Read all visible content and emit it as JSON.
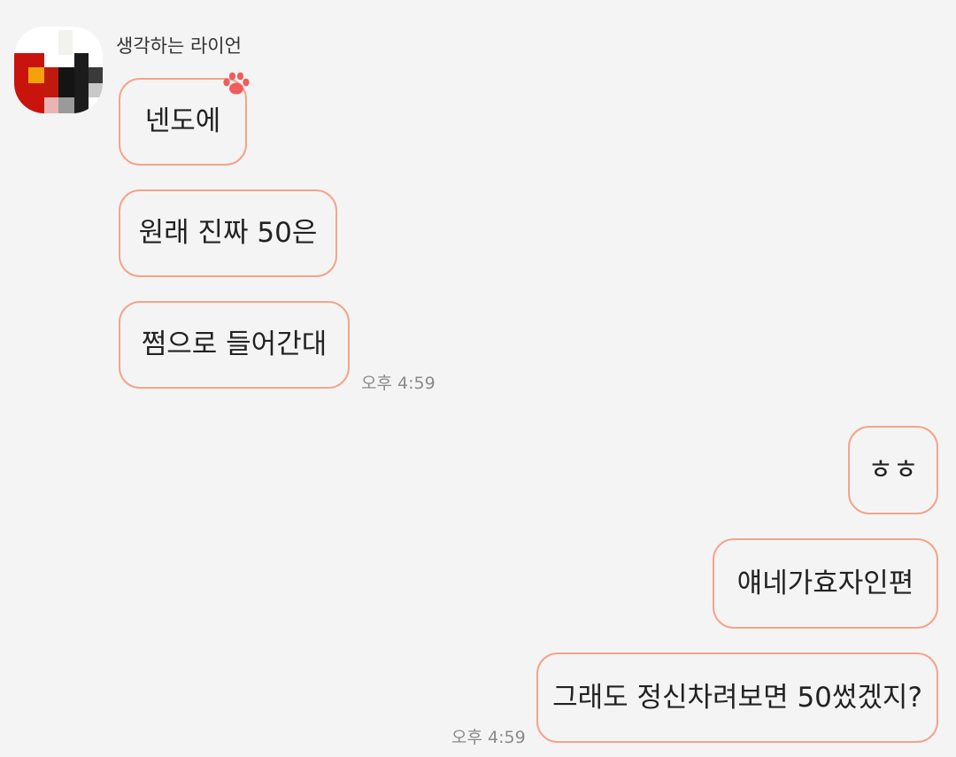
{
  "chat": {
    "sender_name": "생각하는 라이언",
    "incoming": [
      {
        "text": "넨도에"
      },
      {
        "text": "원래 진짜 50은"
      },
      {
        "text": "쩜으로 들어간대"
      }
    ],
    "incoming_time": "오후 4:59",
    "outgoing": [
      {
        "text": "ㅎㅎ"
      },
      {
        "text": "얘네가효자인편"
      },
      {
        "text": "그래도 정신차려보면 50썼겠지?"
      }
    ],
    "outgoing_time": "오후 4:59"
  },
  "colors": {
    "background": "#f4f4f4",
    "bubble_border": "#f4a48a",
    "paw_icon": "#f25c5c"
  }
}
